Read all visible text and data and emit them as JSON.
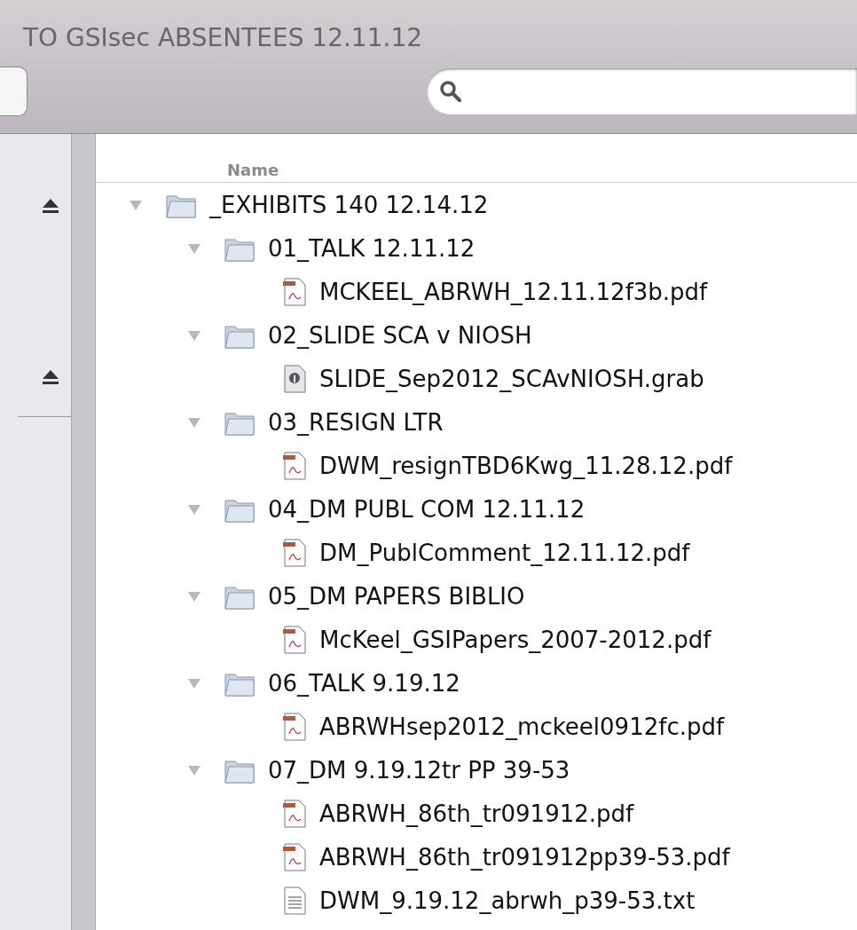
{
  "window": {
    "title": "TO GSIsec ABSENTEES 12.11.12"
  },
  "table": {
    "columns": [
      "Name"
    ],
    "tree": [
      {
        "name": "_EXHIBITS 140 12.14.12",
        "kind": "folder",
        "expanded": true,
        "children": [
          {
            "name": "01_TALK 12.11.12",
            "kind": "folder",
            "expanded": true,
            "children": [
              {
                "name": "MCKEEL_ABRWH_12.11.12f3b.pdf",
                "kind": "pdf"
              }
            ]
          },
          {
            "name": "02_SLIDE SCA v NIOSH",
            "kind": "folder",
            "expanded": true,
            "children": [
              {
                "name": "SLIDE_Sep2012_SCAvNIOSH.grab",
                "kind": "grab"
              }
            ]
          },
          {
            "name": "03_RESIGN LTR",
            "kind": "folder",
            "expanded": true,
            "children": [
              {
                "name": "DWM_resignTBD6Kwg_11.28.12.pdf",
                "kind": "pdf"
              }
            ]
          },
          {
            "name": "04_DM PUBL COM 12.11.12",
            "kind": "folder",
            "expanded": true,
            "children": [
              {
                "name": "DM_PublComment_12.11.12.pdf",
                "kind": "pdf"
              }
            ]
          },
          {
            "name": "05_DM PAPERS BIBLIO",
            "kind": "folder",
            "expanded": true,
            "children": [
              {
                "name": "McKeel_GSIPapers_2007-2012.pdf",
                "kind": "pdf"
              }
            ]
          },
          {
            "name": "06_TALK 9.19.12",
            "kind": "folder",
            "expanded": true,
            "children": [
              {
                "name": "ABRWHsep2012_mckeel0912fc.pdf",
                "kind": "pdf"
              }
            ]
          },
          {
            "name": "07_DM 9.19.12tr PP 39-53",
            "kind": "folder",
            "expanded": true,
            "children": [
              {
                "name": "ABRWH_86th_tr091912.pdf",
                "kind": "pdf"
              },
              {
                "name": "ABRWH_86th_tr091912pp39-53.pdf",
                "kind": "pdf"
              },
              {
                "name": "DWM_9.19.12_abrwh_p39-53.txt",
                "kind": "txt"
              }
            ]
          }
        ]
      }
    ]
  }
}
